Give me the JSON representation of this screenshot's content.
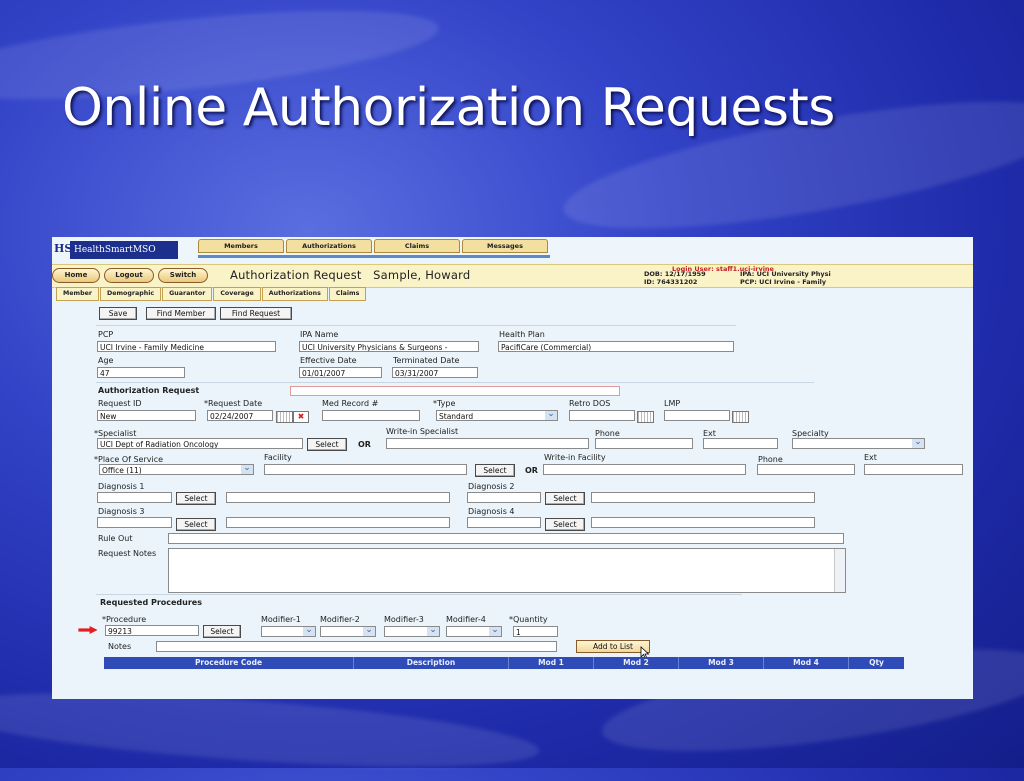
{
  "slide": {
    "title": "Online Authorization Requests"
  },
  "app": {
    "logo_mark": "HS",
    "brand": "HealthSmartMSO",
    "top_tabs": [
      "Members",
      "Authorizations",
      "Claims",
      "Messages"
    ],
    "nav_buttons": [
      "Home",
      "Logout",
      "Switch"
    ],
    "page_title": "Authorization Request",
    "member_name": "Sample, Howard",
    "login_user": "Login User: staff1.uci-irvine",
    "dob": "DOB: 12/17/1959",
    "member_id": "ID: 764331202",
    "ipa": "IPA: UCI University Physi",
    "pcp_info": "PCP: UCI Irvine - Family",
    "sub_tabs": [
      "Member",
      "Demographic",
      "Guarantor",
      "Coverage",
      "Authorizations",
      "Claims"
    ]
  },
  "toolbar": {
    "save": "Save",
    "find_member": "Find Member",
    "find_request": "Find Request"
  },
  "member": {
    "pcp_label": "PCP",
    "pcp_value": "UCI Irvine - Family Medicine",
    "ipa_label": "IPA Name",
    "ipa_value": "UCI University Physicians & Surgeons -",
    "plan_label": "Health Plan",
    "plan_value": "PacifiCare (Commercial)",
    "age_label": "Age",
    "age_value": "47",
    "eff_label": "Effective Date",
    "eff_value": "01/01/2007",
    "term_label": "Terminated Date",
    "term_value": "03/31/2007"
  },
  "auth": {
    "section": "Authorization Request",
    "request_id_label": "Request ID",
    "request_id_value": "New",
    "request_date_label": "*Request Date",
    "request_date_value": "02/24/2007",
    "med_record_label": "Med Record #",
    "type_label": "*Type",
    "type_value": "Standard",
    "retro_label": "Retro DOS",
    "lmp_label": "LMP",
    "specialist_label": "*Specialist",
    "specialist_value": "UCI Dept of Radiation Oncology",
    "select": "Select",
    "or": "OR",
    "writein_specialist_label": "Write-in Specialist",
    "phone_label": "Phone",
    "ext_label": "Ext",
    "specialty_label": "Specialty",
    "place_label": "*Place Of Service",
    "place_value": "Office (11)",
    "facility_label": "Facility",
    "writein_facility_label": "Write-in Facility",
    "dx1": "Diagnosis 1",
    "dx2": "Diagnosis 2",
    "dx3": "Diagnosis 3",
    "dx4": "Diagnosis 4",
    "rule_out": "Rule Out",
    "notes_label": "Request Notes"
  },
  "procedures": {
    "section": "Requested Procedures",
    "procedure_label": "*Procedure",
    "procedure_value": "99213",
    "mod1": "Modifier-1",
    "mod2": "Modifier-2",
    "mod3": "Modifier-3",
    "mod4": "Modifier-4",
    "qty_label": "*Quantity",
    "qty_value": "1",
    "notes_label": "Notes",
    "add_to_list": "Add to List",
    "columns": [
      "Procedure Code",
      "Description",
      "Mod 1",
      "Mod 2",
      "Mod 3",
      "Mod 4",
      "Qty"
    ]
  }
}
